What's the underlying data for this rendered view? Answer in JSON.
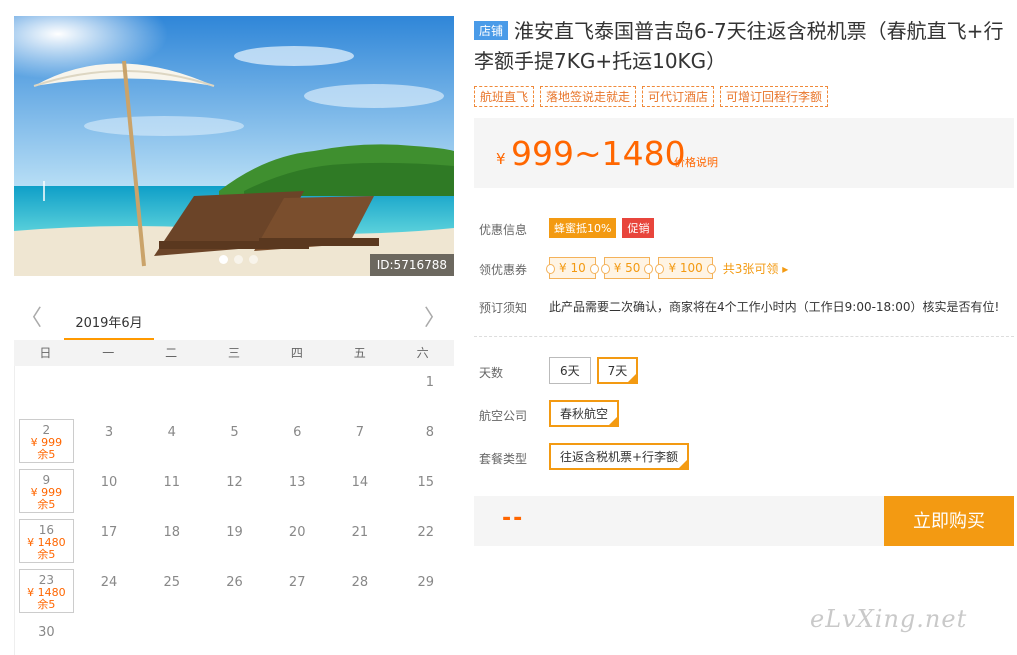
{
  "hero": {
    "id_badge": "ID:5716788",
    "dots": 3
  },
  "calendar": {
    "prev": "〈",
    "next": "〉",
    "month": "2019年6月",
    "weekdays": [
      "日",
      "一",
      "二",
      "三",
      "四",
      "五",
      "六"
    ],
    "days": [
      {
        "n": ""
      },
      {
        "n": ""
      },
      {
        "n": ""
      },
      {
        "n": ""
      },
      {
        "n": ""
      },
      {
        "n": ""
      },
      {
        "n": "1"
      },
      {
        "n": "2",
        "price": "¥ 999",
        "stock": "余5"
      },
      {
        "n": "3"
      },
      {
        "n": "4"
      },
      {
        "n": "5"
      },
      {
        "n": "6"
      },
      {
        "n": "7"
      },
      {
        "n": "8"
      },
      {
        "n": "9",
        "price": "¥ 999",
        "stock": "余5"
      },
      {
        "n": "10"
      },
      {
        "n": "11"
      },
      {
        "n": "12"
      },
      {
        "n": "13"
      },
      {
        "n": "14"
      },
      {
        "n": "15"
      },
      {
        "n": "16",
        "price": "¥ 1480",
        "stock": "余5"
      },
      {
        "n": "17"
      },
      {
        "n": "18"
      },
      {
        "n": "19"
      },
      {
        "n": "20"
      },
      {
        "n": "21"
      },
      {
        "n": "22"
      },
      {
        "n": "23",
        "price": "¥ 1480",
        "stock": "余5"
      },
      {
        "n": "24"
      },
      {
        "n": "25"
      },
      {
        "n": "26"
      },
      {
        "n": "27"
      },
      {
        "n": "28"
      },
      {
        "n": "29"
      },
      {
        "n": "30"
      }
    ]
  },
  "product": {
    "shop_tag": "店铺",
    "title": "淮安直飞泰国普吉岛6-7天往返含税机票（春航直飞+行李额手提7KG+托运10KG）",
    "tags": [
      "航班直飞",
      "落地签说走就走",
      "可代订酒店",
      "可增订回程行李额"
    ]
  },
  "price": {
    "currency": "¥",
    "range": "999~1480",
    "explain": "价格说明"
  },
  "promo": {
    "label": "优惠信息",
    "pills": [
      "蜂蜜抵10%",
      "促销"
    ]
  },
  "coupons": {
    "label": "领优惠券",
    "items": [
      "¥ 10",
      "¥ 50",
      "¥ 100"
    ],
    "more": "共3张可领 ▸"
  },
  "notice": {
    "label": "预订须知",
    "text": "此产品需要二次确认，商家将在4个工作小时内（工作日9:00-18:00）核实是否有位!"
  },
  "options": {
    "days_label": "天数",
    "days": [
      "6天",
      "7天"
    ],
    "airline_label": "航空公司",
    "airline": "春秋航空",
    "package_label": "套餐类型",
    "package": "往返含税机票+行李额"
  },
  "buy": {
    "total": "--",
    "button": "立即购买"
  },
  "watermark": "eLvXing.net",
  "colors": {
    "accent": "#f39a12",
    "price": "#ff6600",
    "shop_tag": "#4a9be8",
    "promo_red": "#e8453c"
  }
}
